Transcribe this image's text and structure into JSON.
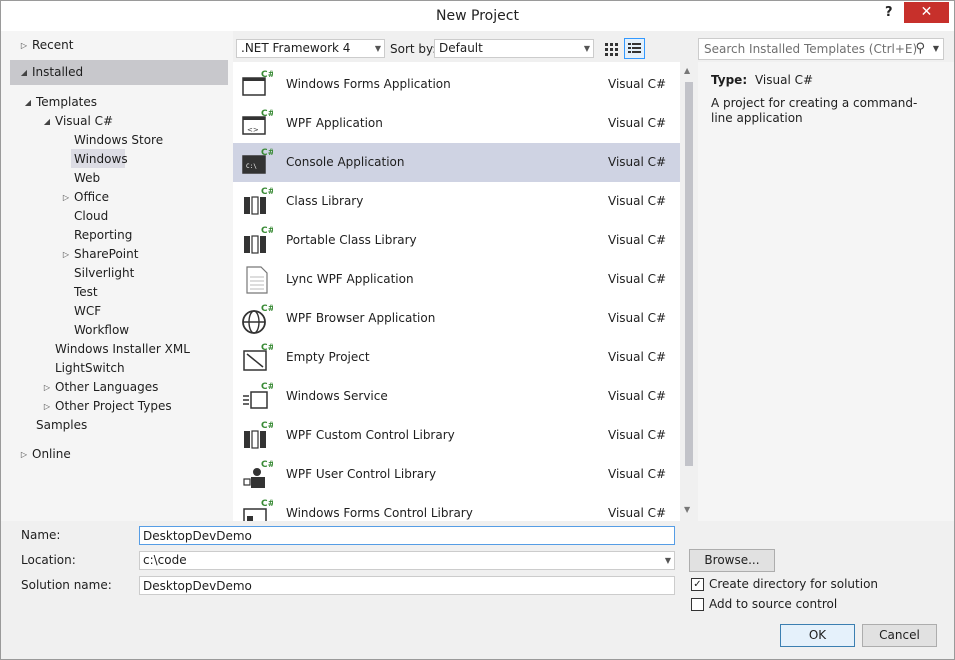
{
  "window": {
    "title": "New Project",
    "help": "?",
    "close": "✕"
  },
  "tree": {
    "recent": "Recent",
    "installed": "Installed",
    "templates": "Templates",
    "visual_csharp": "Visual C#",
    "children": [
      {
        "label": "Windows Store"
      },
      {
        "label": "Windows"
      },
      {
        "label": "Web"
      },
      {
        "label": "Office"
      },
      {
        "label": "Cloud"
      },
      {
        "label": "Reporting"
      },
      {
        "label": "SharePoint"
      },
      {
        "label": "Silverlight"
      },
      {
        "label": "Test"
      },
      {
        "label": "WCF"
      },
      {
        "label": "Workflow"
      }
    ],
    "windows_installer_xml": "Windows Installer XML",
    "lightswitch": "LightSwitch",
    "other_languages": "Other Languages",
    "other_project_types": "Other Project Types",
    "samples": "Samples",
    "online": "Online"
  },
  "toolbar": {
    "framework": ".NET Framework 4",
    "sort_by_label": "Sort by:",
    "sort_by_value": "Default",
    "search_placeholder": "Search Installed Templates (Ctrl+E)"
  },
  "templates": [
    {
      "name": "Windows Forms Application",
      "lang": "Visual C#",
      "icon": "windows-forms-icon"
    },
    {
      "name": "WPF Application",
      "lang": "Visual C#",
      "icon": "wpf-application-icon"
    },
    {
      "name": "Console Application",
      "lang": "Visual C#",
      "icon": "console-icon"
    },
    {
      "name": "Class Library",
      "lang": "Visual C#",
      "icon": "class-library-icon"
    },
    {
      "name": "Portable Class Library",
      "lang": "Visual C#",
      "icon": "portable-library-icon"
    },
    {
      "name": "Lync WPF Application",
      "lang": "Visual C#",
      "icon": "document-icon"
    },
    {
      "name": "WPF Browser Application",
      "lang": "Visual C#",
      "icon": "globe-icon"
    },
    {
      "name": "Empty Project",
      "lang": "Visual C#",
      "icon": "empty-project-icon"
    },
    {
      "name": "Windows Service",
      "lang": "Visual C#",
      "icon": "service-icon"
    },
    {
      "name": "WPF Custom Control Library",
      "lang": "Visual C#",
      "icon": "control-library-icon"
    },
    {
      "name": "WPF User Control Library",
      "lang": "Visual C#",
      "icon": "user-control-icon"
    },
    {
      "name": "Windows Forms Control Library",
      "lang": "Visual C#",
      "icon": "forms-control-icon"
    }
  ],
  "description": {
    "type_label": "Type:",
    "type_value": "Visual C#",
    "text": "A project for creating a command-line application"
  },
  "form": {
    "name_label": "Name:",
    "name_value": "DesktopDevDemo",
    "location_label": "Location:",
    "location_value": "c:\\code",
    "solution_label": "Solution name:",
    "solution_value": "DesktopDevDemo",
    "browse": "Browse...",
    "create_directory": "Create directory for solution",
    "create_directory_checked": true,
    "source_control": "Add to source control",
    "source_control_checked": false,
    "ok": "OK",
    "cancel": "Cancel"
  }
}
